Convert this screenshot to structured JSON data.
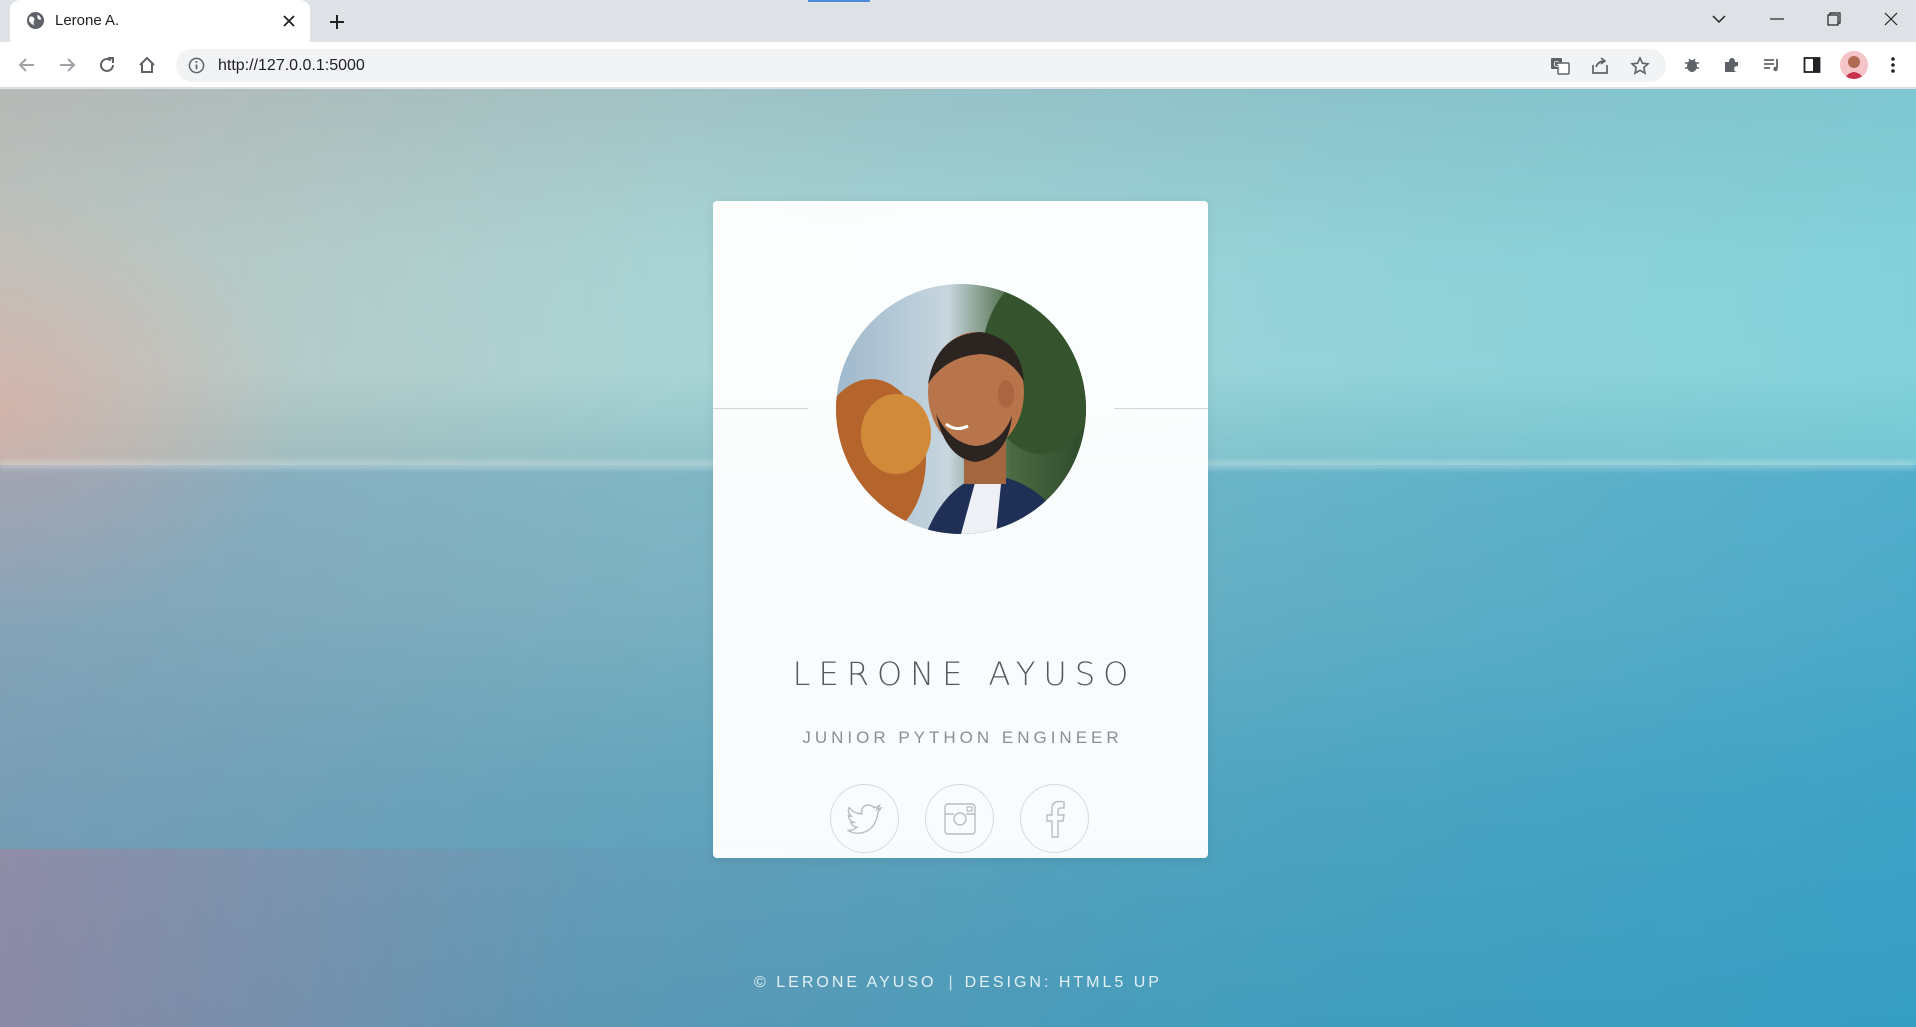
{
  "browser": {
    "tab_title": "Lerone A.",
    "url": "http://127.0.0.1:5000"
  },
  "profile": {
    "name": "LERONE AYUSO",
    "title": "JUNIOR PYTHON ENGINEER",
    "socials": [
      "twitter-icon",
      "instagram-icon",
      "facebook-icon"
    ]
  },
  "footer": {
    "copyright": "© LERONE AYUSO",
    "design": "DESIGN: HTML5 UP"
  },
  "colors": {
    "card": "#ffffff",
    "text": "#555a60",
    "accent": "#4b8bd9"
  }
}
